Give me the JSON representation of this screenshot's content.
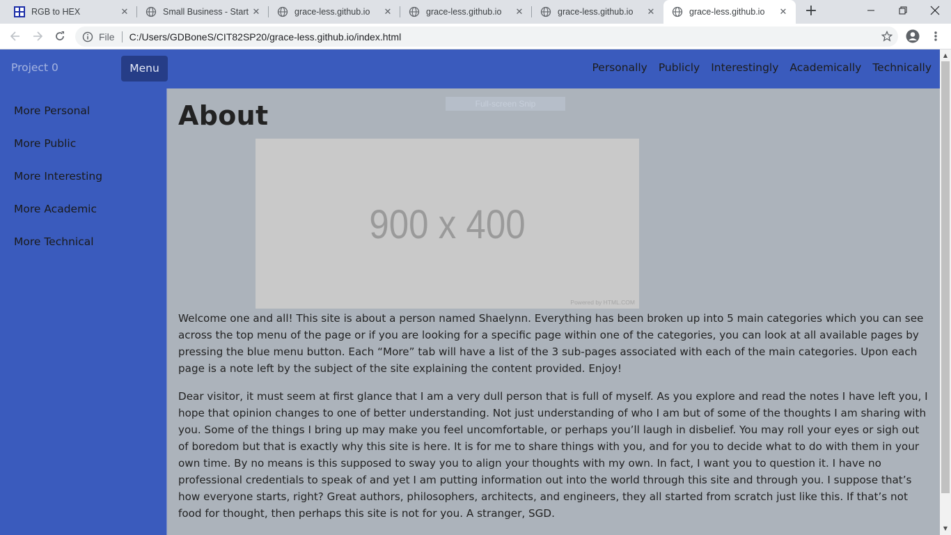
{
  "browser": {
    "tabs": [
      {
        "title": "RGB to HEX",
        "active": false,
        "favicon": "rgb-hex-favicon"
      },
      {
        "title": "Small Business - Start Bootstrap",
        "active": false,
        "favicon": "globe-icon"
      },
      {
        "title": "grace-less.github.io",
        "active": false,
        "favicon": "globe-icon"
      },
      {
        "title": "grace-less.github.io",
        "active": false,
        "favicon": "globe-icon"
      },
      {
        "title": "grace-less.github.io",
        "active": false,
        "favicon": "globe-icon"
      },
      {
        "title": "grace-less.github.io",
        "active": true,
        "favicon": "globe-icon"
      }
    ],
    "address": {
      "scheme_label": "File",
      "url": "C:/Users/GDBoneS/CIT82SP20/grace-less.github.io/index.html"
    }
  },
  "page": {
    "navbar": {
      "brand": "Project 0",
      "menu_button": "Menu",
      "links": [
        "Personally",
        "Publicly",
        "Interestingly",
        "Academically",
        "Technically"
      ]
    },
    "sidebar": {
      "items": [
        "More Personal",
        "More Public",
        "More Interesting",
        "More Academic",
        "More Technical"
      ]
    },
    "snip_overlay": "Full-screen Snip",
    "heading": "About",
    "image": {
      "label": "900 x 400",
      "credit": "Powered by HTML.COM"
    },
    "paragraphs": [
      "Welcome one and all! This site is about a person named Shaelynn. Everything has been broken up into 5 main categories which you can see across the top menu of the page or if you are looking for a specific page within one of the categories, you can look at all available pages by pressing the blue menu button. Each “More” tab will have a list of the 3 sub-pages associated with each of the main categories. Upon each page is a note left by the subject of the site explaining the content provided. Enjoy!",
      "Dear visitor, it must seem at first glance that I am a very dull person that is full of myself. As you explore and read the notes I have left you, I hope that opinion changes to one of better understanding. Not just understanding of who I am but of some of the thoughts I am sharing with you. Some of the things I bring up may make you feel uncomfortable, or perhaps you’ll laugh in disbelief. You may roll your eyes or sigh out of boredom but that is exactly why this site is here. It is for me to share things with you, and for you to decide what to do with them in your own time. By no means is this supposed to sway you to align your thoughts with my own. In fact, I want you to question it. I have no professional credentials to speak of and yet I am putting information out into the world through this site and through you. I suppose that’s how everyone starts, right? Great authors, philosophers, architects, and engineers, they all started from scratch just like this. If that’s not food for thought, then perhaps this site is not for you. A stranger, SGD."
    ]
  },
  "colors": {
    "navbar_blue": "#3a5bbd",
    "menu_button": "#263d87",
    "content_overlay": "#acb3bb"
  }
}
